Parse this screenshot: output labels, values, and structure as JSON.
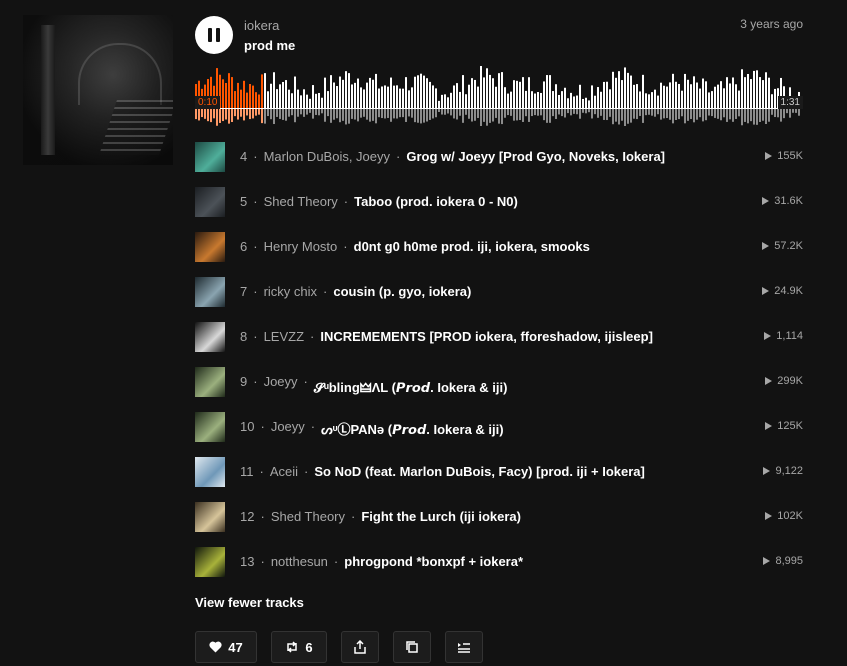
{
  "player": {
    "artist": "iokera",
    "title": "prod me",
    "posted": "3 years ago",
    "current_time": "0:10",
    "duration": "1:31",
    "progress": 0.11,
    "accent_color": "#ff5500",
    "play_state_icon": "pause-icon"
  },
  "tracks": [
    {
      "num": "4",
      "artist": "Marlon DuBois, Joeyy",
      "title": "Grog w/ Joeyy [Prod Gyo, Noveks, Iokera]",
      "plays": "155K",
      "thumb": [
        "#1d4a43",
        "#4fae9a"
      ]
    },
    {
      "num": "5",
      "artist": "Shed Theory",
      "title": "Taboo (prod. iokera 0 - N0)",
      "plays": "31.6K",
      "thumb": [
        "#1b1e22",
        "#4c5258"
      ]
    },
    {
      "num": "6",
      "artist": "Henry Mosto",
      "title": "d0nt g0 h0me prod. iji, iokera, smooks",
      "plays": "57.2K",
      "thumb": [
        "#2a1a0f",
        "#c8792f"
      ]
    },
    {
      "num": "7",
      "artist": "ricky chix",
      "title": "cousin (p. gyo, iokera)",
      "plays": "24.9K",
      "thumb": [
        "#1e2a30",
        "#8aa4b0"
      ]
    },
    {
      "num": "8",
      "artist": "LEVZZ",
      "title": "INCREMEMENTS [PROD iokera, fforeshadow, ijisleep]",
      "plays": "1,114",
      "thumb": [
        "#111111",
        "#d8d8d8"
      ]
    },
    {
      "num": "9",
      "artist": "Joeyy",
      "title": "𝓢ᵘbling🜲ΛL (𝙋𝙧𝙤𝙙. Iokera & iji)",
      "plays": "299K",
      "thumb": [
        "#1f2a1a",
        "#9bb07e"
      ]
    },
    {
      "num": "10",
      "artist": "Joeyy",
      "title": "ᔕᶸⓁΡΑΝə (𝙋𝙧𝙤𝙙. Iokera & iji)",
      "plays": "125K",
      "thumb": [
        "#1f2a1a",
        "#9bb07e"
      ]
    },
    {
      "num": "11",
      "artist": "Aceii",
      "title": "So NoD (feat. Marlon DuBois, Facy) [prod. iji + Iokera]",
      "plays": "9,122",
      "thumb": [
        "#dfe8ee",
        "#6f98b8"
      ]
    },
    {
      "num": "12",
      "artist": "Shed Theory",
      "title": "Fight the Lurch (iji iokera)",
      "plays": "102K",
      "thumb": [
        "#3b3020",
        "#d6c49a"
      ]
    },
    {
      "num": "13",
      "artist": "notthesun",
      "title": "phrogpond *bonxpf + iokera*",
      "plays": "8,995",
      "thumb": [
        "#10160c",
        "#a8b23a"
      ]
    }
  ],
  "view_fewer": "View fewer tracks",
  "actions": {
    "like_count": "47",
    "repost_count": "6"
  }
}
